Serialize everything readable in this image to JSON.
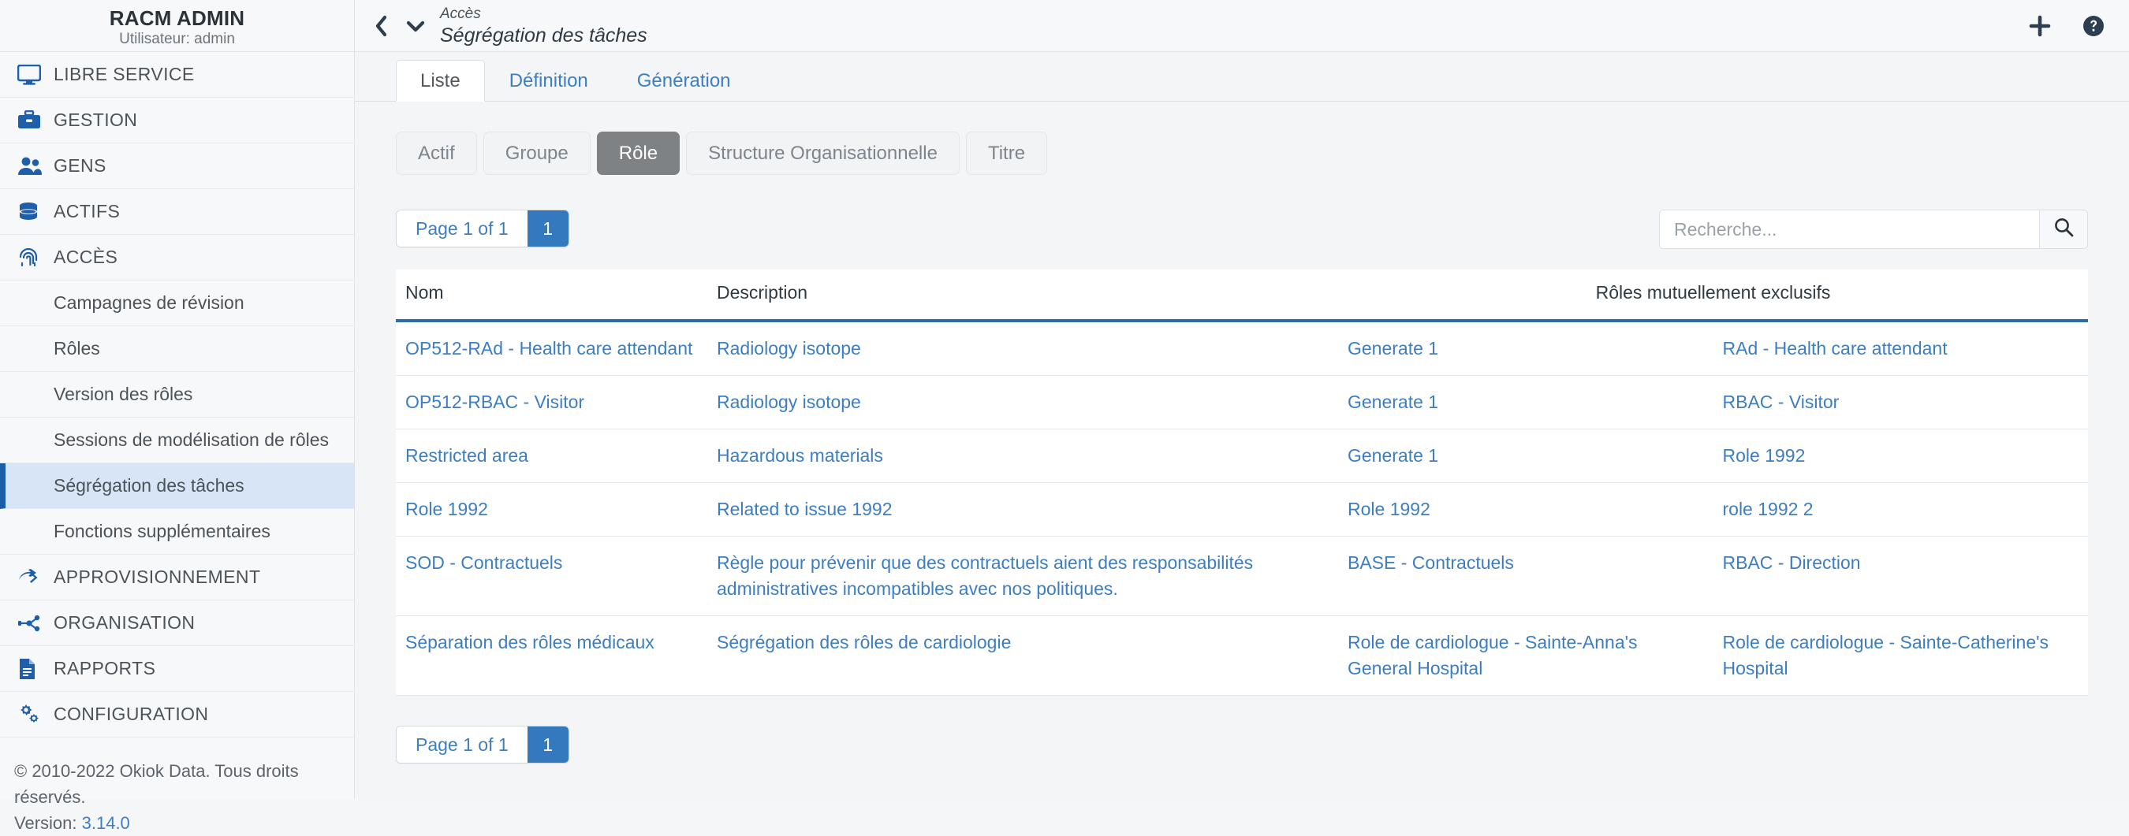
{
  "sidebar": {
    "brand_title": "RACM ADMIN",
    "brand_subtitle": "Utilisateur: admin",
    "items": [
      {
        "label": "LIBRE SERVICE",
        "icon": "monitor-icon"
      },
      {
        "label": "GESTION",
        "icon": "toolbox-icon"
      },
      {
        "label": "GENS",
        "icon": "people-icon"
      },
      {
        "label": "ACTIFS",
        "icon": "database-icon"
      },
      {
        "label": "ACCÈS",
        "icon": "fingerprint-icon"
      }
    ],
    "sub_items": [
      {
        "label": "Campagnes de révision",
        "active": false
      },
      {
        "label": "Rôles",
        "active": false
      },
      {
        "label": "Version des rôles",
        "active": false
      },
      {
        "label": "Sessions de modélisation de rôles",
        "active": false
      },
      {
        "label": "Ségrégation des tâches",
        "active": true
      },
      {
        "label": "Fonctions supplémentaires",
        "active": false
      }
    ],
    "items_bottom": [
      {
        "label": "APPROVISIONNEMENT",
        "icon": "arrows-right-icon"
      },
      {
        "label": "ORGANISATION",
        "icon": "network-icon"
      },
      {
        "label": "RAPPORTS",
        "icon": "document-icon"
      },
      {
        "label": "CONFIGURATION",
        "icon": "gears-icon"
      }
    ],
    "footer": {
      "copyright": "© 2010-2022 Okiok Data. Tous droits réservés.",
      "version_label": "Version:",
      "version_value": "3.14.0"
    }
  },
  "topbar": {
    "breadcrumb_parent": "Accès",
    "breadcrumb_title": "Ségrégation des tâches",
    "back_icon": "chevron-left-icon",
    "dropdown_icon": "chevron-down-icon",
    "add_icon": "plus-icon",
    "help_icon": "help-circle-icon"
  },
  "tabs": [
    {
      "label": "Liste",
      "active": true
    },
    {
      "label": "Définition",
      "active": false
    },
    {
      "label": "Génération",
      "active": false
    }
  ],
  "pills": [
    {
      "label": "Actif",
      "active": false
    },
    {
      "label": "Groupe",
      "active": false
    },
    {
      "label": "Rôle",
      "active": true
    },
    {
      "label": "Structure Organisationnelle",
      "active": false
    },
    {
      "label": "Titre",
      "active": false
    }
  ],
  "pager": {
    "page_label": "Page 1 of 1",
    "page_number": "1"
  },
  "search": {
    "placeholder": "Recherche...",
    "value": "",
    "icon": "search-icon"
  },
  "table": {
    "headers": {
      "nom": "Nom",
      "description": "Description",
      "exclusive": "Rôles mutuellement exclusifs"
    },
    "rows": [
      {
        "nom": "OP512-RAd - Health care attendant",
        "description": "Radiology isotope",
        "role_a": "Generate 1",
        "role_b": "RAd - Health care attendant"
      },
      {
        "nom": "OP512-RBAC - Visitor",
        "description": "Radiology isotope",
        "role_a": "Generate 1",
        "role_b": "RBAC - Visitor"
      },
      {
        "nom": "Restricted area",
        "description": "Hazardous materials",
        "role_a": "Generate 1",
        "role_b": "Role 1992"
      },
      {
        "nom": "Role 1992",
        "description": "Related to issue 1992",
        "role_a": "Role 1992",
        "role_b": "role 1992 2"
      },
      {
        "nom": "SOD - Contractuels",
        "description": "Règle pour prévenir que des contractuels aient des responsabilités administratives incompatibles avec nos politiques.",
        "role_a": "BASE - Contractuels",
        "role_b": "RBAC - Direction"
      },
      {
        "nom": "Séparation des rôles médicaux",
        "description": "Ségrégation des rôles de cardiologie",
        "role_a": "Role de cardiologue - Sainte-Anna's General Hospital",
        "role_b": "Role de cardiologue - Sainte-Catherine's Hospital"
      }
    ]
  },
  "colors": {
    "link": "#3d7ec2",
    "accent_blue": "#3479bd",
    "header_rule": "#2f6aa8",
    "sidebar_icon": "#1f5fa9",
    "active_sub_bg": "#d7e5f7",
    "active_pill_bg": "#7f8285"
  }
}
